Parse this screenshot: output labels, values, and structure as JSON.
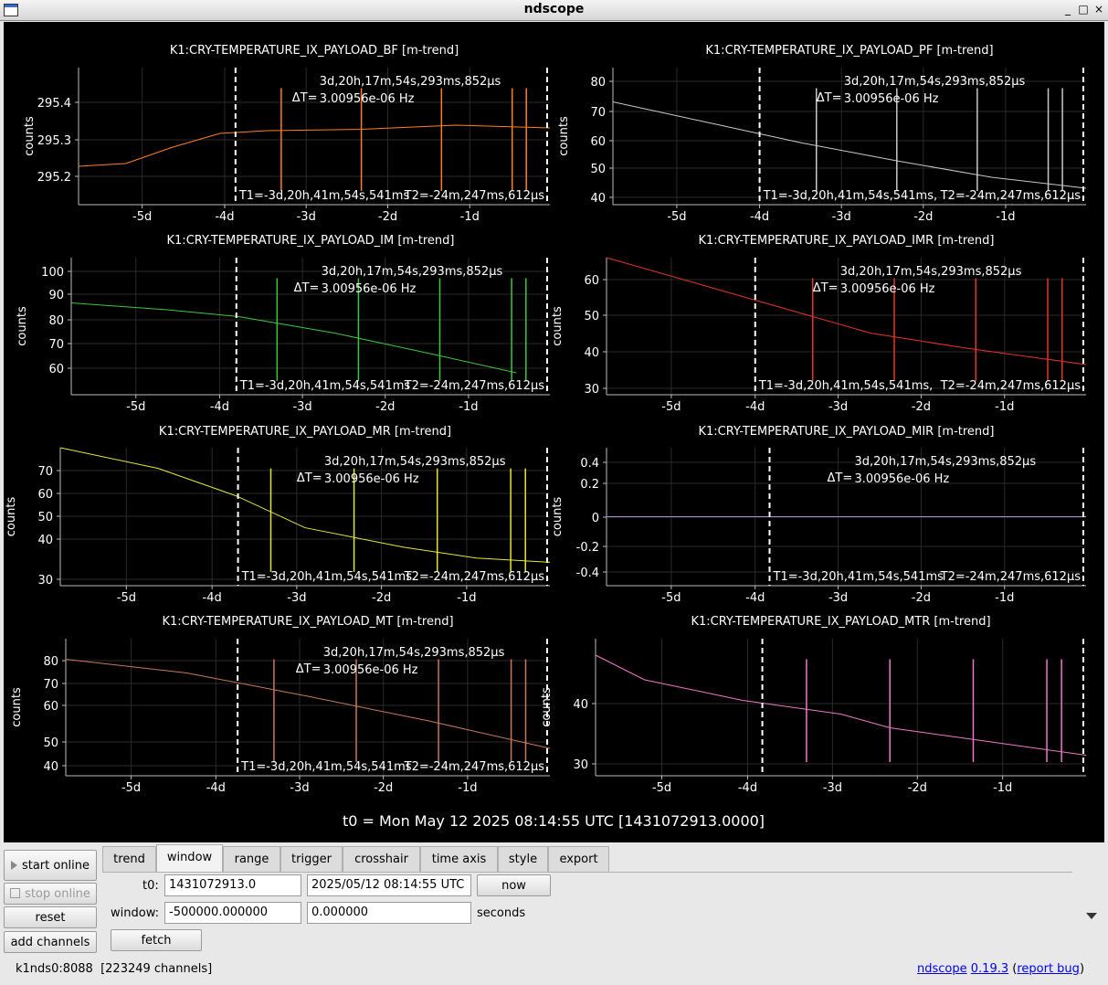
{
  "window": {
    "title": "ndscope"
  },
  "plots": [
    {
      "title": "K1:CRY-TEMPERATURE_IX_PAYLOAD_BF [m-trend]",
      "ylabel": "counts",
      "color": "#ff7f1e",
      "yticks": [
        "295.4",
        "295.3",
        "295.2"
      ],
      "xticks": [
        "-5d",
        "-4d",
        "-3d",
        "-2d",
        "-1d"
      ],
      "delta_t": "ΔT=",
      "delta_value": "3d,20h,17m,54s,293ms,852μs",
      "delta_freq": "3.00956e-06 Hz",
      "t1": "T1=-3d,20h,41m,54s,541ms",
      "t2": "T2=-24m,247ms,612μs"
    },
    {
      "title": "K1:CRY-TEMPERATURE_IX_PAYLOAD_PF [m-trend]",
      "ylabel": "counts",
      "color": "#c8c8c8",
      "yticks": [
        "80",
        "70",
        "60",
        "50",
        "40"
      ],
      "xticks": [
        "-5d",
        "-4d",
        "-3d",
        "-2d",
        "-1d"
      ],
      "delta_t": "ΔT=",
      "delta_value": "3d,20h,17m,54s,293ms,852μs",
      "delta_freq": "3.00956e-06 Hz",
      "t1": "T1=-3d,20h,41m,54s,541ms,",
      "t2": "T2=-24m,247ms,612μs"
    },
    {
      "title": "K1:CRY-TEMPERATURE_IX_PAYLOAD_IM [m-trend]",
      "ylabel": "counts",
      "color": "#3cc83c",
      "yticks": [
        "100",
        "90",
        "80",
        "70",
        "60"
      ],
      "xticks": [
        "-5d",
        "-4d",
        "-3d",
        "-2d",
        "-1d"
      ],
      "delta_t": "ΔT=",
      "delta_value": "3d,20h,17m,54s,293ms,852μs",
      "delta_freq": "3.00956e-06 Hz",
      "t1": "T1=-3d,20h,41m,54s,541ms",
      "t2": "T2=-24m,247ms,612μs"
    },
    {
      "title": "K1:CRY-TEMPERATURE_IX_PAYLOAD_IMR [m-trend]",
      "ylabel": "counts",
      "color": "#e8322a",
      "yticks": [
        "60",
        "50",
        "40",
        "30"
      ],
      "xticks": [
        "-5d",
        "-4d",
        "-3d",
        "-2d",
        "-1d"
      ],
      "delta_t": "ΔT=",
      "delta_value": "3d,20h,17m,54s,293ms,852μs",
      "delta_freq": "3.00956e-06 Hz",
      "t1": "T1=-3d,20h,41m,54s,541ms,",
      "t2": "T2=-24m,247ms,612μs"
    },
    {
      "title": "K1:CRY-TEMPERATURE_IX_PAYLOAD_MR [m-trend]",
      "ylabel": "counts",
      "color": "#e6e632",
      "yticks": [
        "70",
        "60",
        "50",
        "40",
        "30"
      ],
      "xticks": [
        "-5d",
        "-4d",
        "-3d",
        "-2d",
        "-1d"
      ],
      "delta_t": "ΔT=",
      "delta_value": "3d,20h,17m,54s,293ms,852μs",
      "delta_freq": "3.00956e-06 Hz",
      "t1": "T1=-3d,20h,41m,54s,541ms",
      "t2": "T2=-24m,247ms,612μs"
    },
    {
      "title": "K1:CRY-TEMPERATURE_IX_PAYLOAD_MIR [m-trend]",
      "ylabel": "counts",
      "color": "#b48cdc",
      "yticks": [
        "0.4",
        "0.2",
        "0",
        "-0.2",
        "-0.4"
      ],
      "xticks": [
        "-5d",
        "-4d",
        "-3d",
        "-2d",
        "-1d"
      ],
      "delta_t": "ΔT=",
      "delta_value": "3d,20h,17m,54s,293ms,852μs",
      "delta_freq": "3.00956e-06 Hz",
      "t1": "T1=-3d,20h,41m,54s,541ms",
      "t2": "T2=-24m,247ms,612μs"
    },
    {
      "title": "K1:CRY-TEMPERATURE_IX_PAYLOAD_MT [m-trend]",
      "ylabel": "counts",
      "color": "#c8785a",
      "yticks": [
        "80",
        "70",
        "60",
        "50",
        "40"
      ],
      "xticks": [
        "-5d",
        "-4d",
        "-3d",
        "-2d",
        "-1d"
      ],
      "delta_t": "ΔT=",
      "delta_value": "3d,20h,17m,54s,293ms,852μs",
      "delta_freq": "3.00956e-06 Hz",
      "t1": "T1=-3d,20h,41m,54s,541ms",
      "t2": "T2=-24m,247ms,612μs"
    },
    {
      "title": "K1:CRY-TEMPERATURE_IX_PAYLOAD_MTR [m-trend]",
      "ylabel": "counts",
      "color": "#f078c8",
      "yticks": [
        "40",
        "30"
      ],
      "xticks": [
        "-5d",
        "-4d",
        "-3d",
        "-2d",
        "-1d"
      ],
      "delta_t": "",
      "delta_value": "",
      "delta_freq": "",
      "t1": "",
      "t2": ""
    }
  ],
  "t0_label": "t0 = Mon May 12 2025 08:14:55 UTC [1431072913.0000]",
  "controls": {
    "start_online": "start online",
    "stop_online": "stop online",
    "reset": "reset",
    "add_channels": "add channels"
  },
  "tabs": [
    "trend",
    "window",
    "range",
    "trigger",
    "crosshair",
    "time axis",
    "style",
    "export"
  ],
  "active_tab": "window",
  "window_tab": {
    "t0_label": "t0:",
    "t0_gps": "1431072913.0",
    "t0_utc": "2025/05/12 08:14:55 UTC",
    "now_button": "now",
    "window_label": "window:",
    "window_start": "-500000.000000",
    "window_end": "0.000000",
    "seconds_label": "seconds",
    "fetch_button": "fetch"
  },
  "status": {
    "server": "k1nds0:8088",
    "channels": "[223249 channels]",
    "app_link": "ndscope",
    "version_link": "0.19.3",
    "report_bug": "report bug"
  }
}
